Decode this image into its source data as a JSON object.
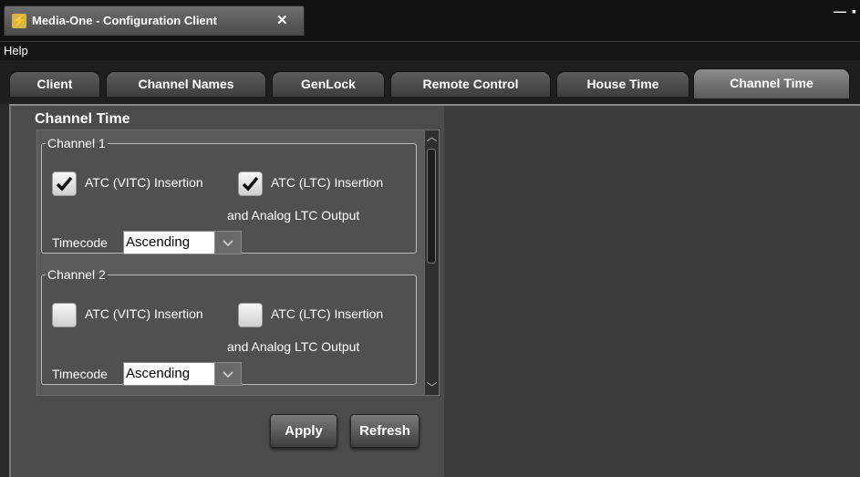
{
  "window": {
    "title": "Media-One - Configuration Client",
    "close_tab_icon": "close-icon",
    "minimize_icon": "minimize-icon",
    "maximize_icon": "maximize-icon"
  },
  "menu": {
    "help": "Help"
  },
  "tabs": [
    {
      "label": "Client",
      "active": false
    },
    {
      "label": "Channel Names",
      "active": false
    },
    {
      "label": "GenLock",
      "active": false
    },
    {
      "label": "Remote Control",
      "active": false
    },
    {
      "label": "House Time",
      "active": false
    },
    {
      "label": "Channel Time",
      "active": true
    }
  ],
  "panel": {
    "title": "Channel Time",
    "channels": [
      {
        "name": "Channel 1",
        "vitc_label": "ATC (VITC) Insertion",
        "vitc_checked": true,
        "ltc_label_line1": "ATC (LTC) Insertion",
        "ltc_label_line2": "and Analog LTC Output",
        "ltc_checked": true,
        "timecode_label": "Timecode",
        "timecode_value": "Ascending"
      },
      {
        "name": "Channel 2",
        "vitc_label": "ATC (VITC) Insertion",
        "vitc_checked": false,
        "ltc_label_line1": "ATC (LTC) Insertion",
        "ltc_label_line2": "and Analog LTC Output",
        "ltc_checked": false,
        "timecode_label": "Timecode",
        "timecode_value": "Ascending"
      }
    ]
  },
  "buttons": {
    "apply": "Apply",
    "refresh": "Refresh"
  },
  "colors": {
    "background": "#2a2a2a",
    "panel": "#4b4b4b",
    "text": "#ffffff",
    "accent_icon": "#d8b24a"
  }
}
